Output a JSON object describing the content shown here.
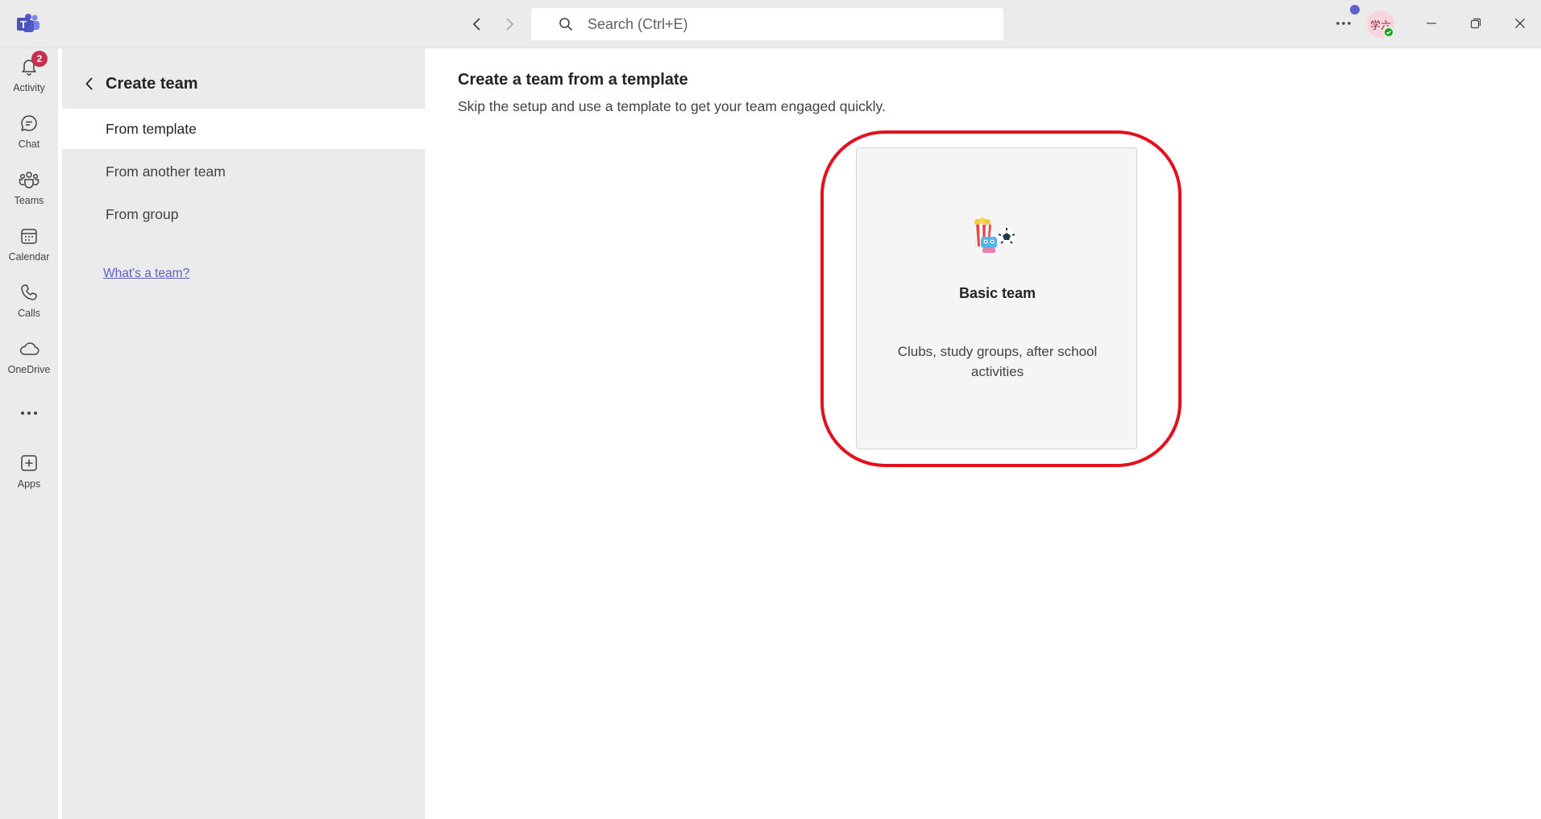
{
  "titlebar": {
    "search_placeholder": "Search (Ctrl+E)",
    "avatar_initials": "学六",
    "accent_color": "#5b5fc7"
  },
  "rail": {
    "items": [
      {
        "label": "Activity",
        "icon": "bell-icon",
        "badge": "2"
      },
      {
        "label": "Chat",
        "icon": "chat-icon"
      },
      {
        "label": "Teams",
        "icon": "teams-icon"
      },
      {
        "label": "Calendar",
        "icon": "calendar-icon"
      },
      {
        "label": "Calls",
        "icon": "phone-icon"
      },
      {
        "label": "OneDrive",
        "icon": "cloud-icon"
      },
      {
        "label": "",
        "icon": "more-horizontal-icon"
      },
      {
        "label": "Apps",
        "icon": "add-apps-icon"
      }
    ]
  },
  "panel": {
    "title": "Create team",
    "items": [
      {
        "label": "From template",
        "selected": true
      },
      {
        "label": "From another team"
      },
      {
        "label": "From group"
      }
    ],
    "help_link": "What's a team?"
  },
  "main": {
    "title": "Create a team from a template",
    "subtitle": "Skip the setup and use a template to get your team engaged quickly.",
    "templates": [
      {
        "title": "Basic team",
        "description": "Clubs, study groups, after school activities",
        "icon": "popcorn-soccer-icon"
      }
    ],
    "highlight_color": "#e3101d"
  }
}
